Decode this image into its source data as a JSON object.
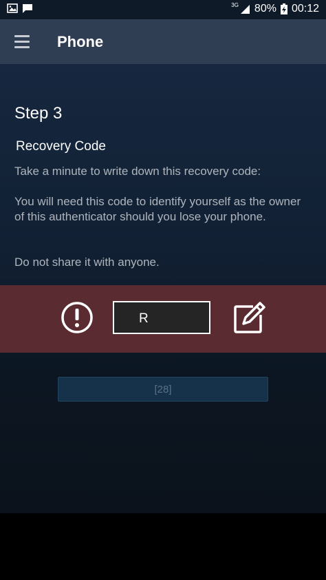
{
  "status_bar": {
    "network": "3G",
    "battery": "80%",
    "time": "00:12"
  },
  "app_bar": {
    "title": "Phone"
  },
  "content": {
    "step_title": "Step 3",
    "section_title": "Recovery Code",
    "paragraph_1": "Take a minute to write down this recovery code:",
    "paragraph_2": "You will need this code to identify yourself as the owner of this authenticator should you lose your phone.",
    "paragraph_3": "Do not share it with anyone."
  },
  "recovery": {
    "code": "R"
  },
  "button": {
    "label": "[28]"
  },
  "colors": {
    "app_bar": "#2f3e53",
    "warning_band": "#5a2b30",
    "button": "#16324a"
  },
  "icons": [
    "image-icon",
    "message-icon",
    "signal-icon",
    "battery-icon",
    "menu-icon",
    "alert-icon",
    "edit-icon"
  ]
}
